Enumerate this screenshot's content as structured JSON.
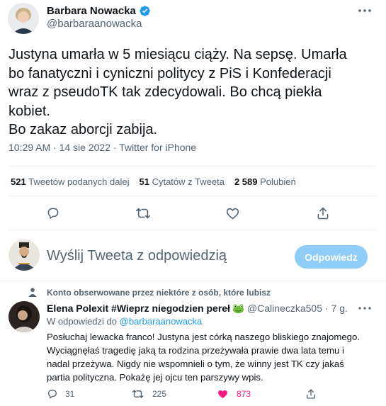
{
  "tweet": {
    "author_name": "Barbara Nowacka",
    "author_handle": "@barbaraanowacka",
    "text_lines": [
      "Justyna umarła w 5 miesiącu ciąży. Na sepsę. Umarła",
      "bo fanatyczni i cyniczni politycy z PiS i Konfederacji",
      "wraz z pseudoTK tak zdecydowali. Bo chcą piekła",
      "kobiet.",
      "Bo zakaz aborcji zabija."
    ],
    "meta": "10:29 AM · 14 sie 2022 · Twitter for iPhone",
    "stats": {
      "retweets_count": "521",
      "retweets_label": "Tweetów podanych dalej",
      "quotes_count": "51",
      "quotes_label": "Cytatów z Tweeta",
      "likes_count": "2 589",
      "likes_label": "Polubień"
    }
  },
  "reply_box": {
    "placeholder": "Wyślij Tweeta z odpowiedzią",
    "button_label": "Odpowiedz"
  },
  "reply": {
    "context_label": "Konto obserwowane przez niektóre z osób, które lubisz",
    "author_name": "Elena Polexit #Wieprz niegodzien pereł",
    "author_handle": "@Calineczka505",
    "time": "· 7 g.",
    "replying_to_prefix": "W odpowiedzi do",
    "replying_to_handle": "@barbaraanowacka",
    "text_lines": [
      "Posłuchaj lewacka franco! Justyna jest córką naszego bliskiego znajomego.",
      "Wyciągnęłaś tragedię jaką ta rodzina przeżywała prawie dwa lata temu i",
      "nadal przeżywa. Nigdy nie wspomnieli o tym, że winny jest TK czy jakaś",
      "partia polityczna. Pokażę jej ojcu ten parszywy wpis."
    ],
    "actions": {
      "reply_count": "31",
      "retweet_count": "225",
      "like_count": "873"
    }
  },
  "colors": {
    "accent": "#1d9bf0",
    "accent_disabled": "#8ecdf8",
    "like_active": "#f91880",
    "muted": "#536471",
    "divider": "#eff3f4"
  },
  "icons": {
    "verified": "verified-badge-icon",
    "more": "more-dots-icon",
    "reply": "reply-bubble-icon",
    "retweet": "retweet-arrows-icon",
    "like": "heart-icon",
    "share": "share-upload-icon",
    "emoji": "frog-emoji-icon",
    "social_context": "person-icon"
  }
}
